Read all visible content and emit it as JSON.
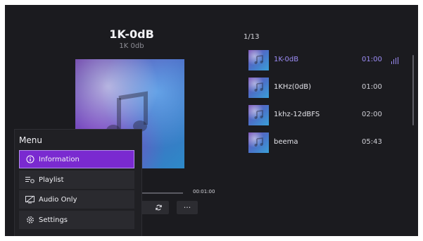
{
  "now_playing": {
    "title": "1K-0dB",
    "subtitle": "1K 0db",
    "total_time": "00:01:00"
  },
  "controls": {
    "repeat_icon": "repeat-icon",
    "more_label": "···"
  },
  "playlist": {
    "counter": "1/13",
    "items": [
      {
        "title": "1K-0dB",
        "duration": "01:00",
        "active": true
      },
      {
        "title": "1KHz(0dB)",
        "duration": "01:00",
        "active": false
      },
      {
        "title": "1khz-12dBFS",
        "duration": "02:00",
        "active": false
      },
      {
        "title": "beema",
        "duration": "05:43",
        "active": false
      }
    ]
  },
  "menu": {
    "title": "Menu",
    "items": [
      {
        "label": "Information",
        "icon": "info-icon",
        "selected": true
      },
      {
        "label": "Playlist",
        "icon": "playlist-icon",
        "selected": false
      },
      {
        "label": "Audio Only",
        "icon": "screen-off-icon",
        "selected": false
      },
      {
        "label": "Settings",
        "icon": "gear-icon",
        "selected": false
      }
    ]
  },
  "colors": {
    "background": "#1b1b1f",
    "accent": "#9c8cf5",
    "menu_selected": "#7a2ad0"
  }
}
